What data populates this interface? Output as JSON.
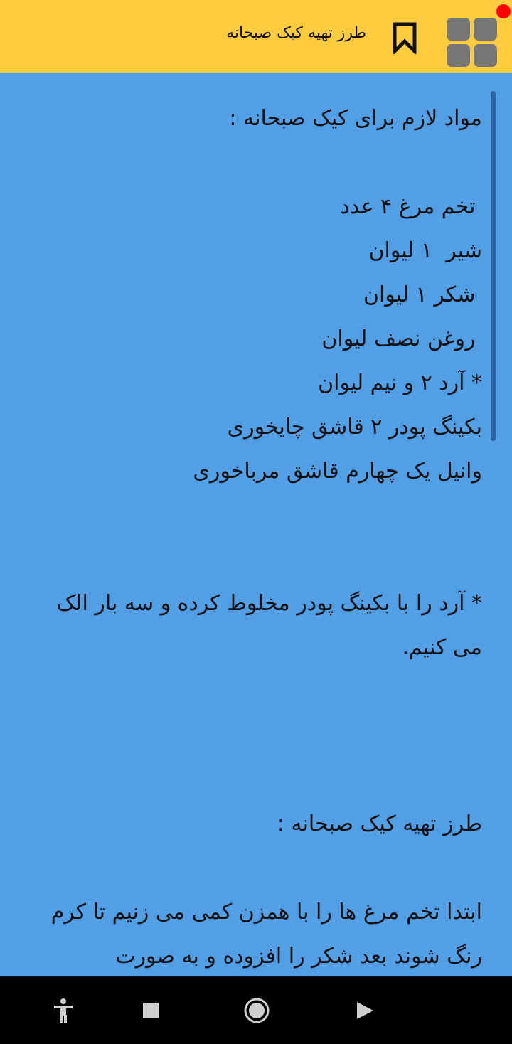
{
  "header": {
    "title": "طرز تهیه کیک صبحانه",
    "accent_color": "#FFCC3F",
    "bookmark_icon": "bookmark-icon",
    "menu_icon": "grid-menu-icon"
  },
  "content": {
    "background_color": "#529FE6",
    "text": "مواد لازم برای کیک صبحانه :\n\n تخم مرغ ۴ عدد\nشیر  ۱ لیوان\n شکر ۱ لیوان\n روغن نصف لیوان\n* آرد ۲ و نیم لیوان\nبکینگ پودر ۲ قاشق چایخوری\nوانیل یک چهارم قاشق مرباخوری\n\n\n* آرد را با بکینگ پودر مخلوط کرده و سه بار الک می کنیم.\n\n\n\nطرز تهیه کیک صبحانه :\n\nابتدا تخم مرغ ها را با همزن کمی می زنیم تا کرم رنگ شوند بعد شکر را افزوده و به صورت"
  },
  "nav_bar": {
    "accessibility_icon": "accessibility-icon",
    "recents_icon": "recents-icon",
    "home_icon": "home-icon",
    "back_icon": "back-icon"
  }
}
